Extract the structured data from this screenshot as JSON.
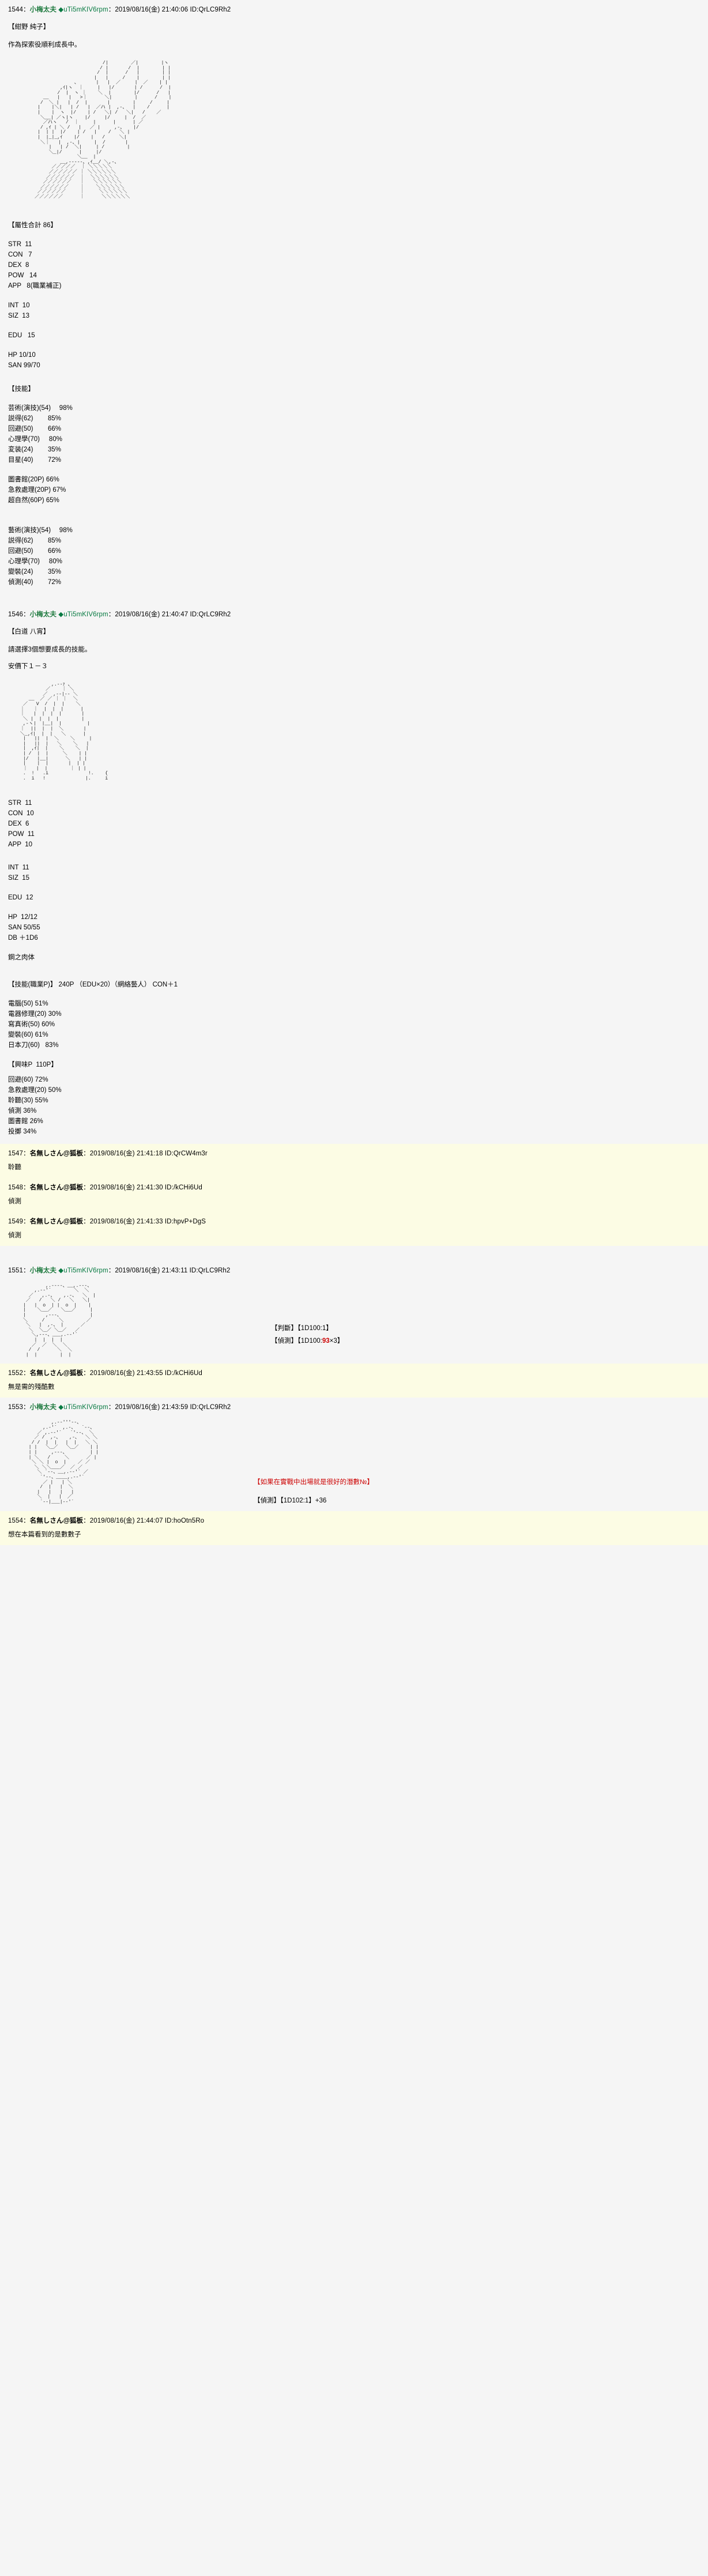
{
  "board": {
    "anon_name": "名無しさん@狐板",
    "trip_name": "小梅太夫",
    "trip_code": "◆uTi5mKIV6rpm",
    "colors": {
      "trip_green": "#1f7a3f",
      "highlight_bg": "#fcfce4",
      "page_bg": "#f5f5f5",
      "dice_red": "#cc0000",
      "dice_blue": "#0000cc"
    }
  },
  "posts": [
    {
      "num": "1544",
      "name": "小梅太夫",
      "trip": "◆uTi5mKIV6rpm",
      "date": "2019/08/16(金) 21:40:06",
      "id": "ID:QrLC9Rh2",
      "title": "【紺野 純子】",
      "line1": "作為探索役順利成長中。",
      "attr_header": "【屬性合計  86】",
      "attrs": [
        "STR  11",
        "CON   7",
        "DEX  8",
        "POW   14",
        "APP   8(職業補正)"
      ],
      "attrs2": [
        "INT  10",
        "SIZ  13"
      ],
      "attrs3": [
        "EDU   15"
      ],
      "attrs4": [
        "HP 10/10",
        "SAN 99/70"
      ],
      "skill_header": "【技能】",
      "skills_a": [
        "芸術(演技)(54)　 98%",
        "説得(62)        85%",
        "回避(50)        66%",
        "心理學(70)     80%",
        "変装(24)        35%",
        "目星(40)        72%"
      ],
      "skills_b": [
        "圖書館(20P) 66%",
        "急救處理(20P) 67%",
        "超自然(60P) 65%"
      ],
      "skills_c": [
        "藝術(演技)(54)　 98%",
        "説得(62)        85%",
        "回避(50)        66%",
        "心理學(70)     80%",
        "變裝(24)        35%",
        "偵測(40)        72%"
      ]
    },
    {
      "num": "1546",
      "name": "小梅太夫",
      "trip": "◆uTi5mKIV6rpm",
      "date": "2019/08/16(金) 21:40:47",
      "id": "ID:QrLC9Rh2",
      "title": "【白道 八宵】",
      "line1": "請選擇3個想要成長的技能。",
      "line2": "安價下１－３",
      "attrs": [
        "STR  11",
        "CON  10",
        "DEX  6",
        "POW  11",
        "APP  10"
      ],
      "attrs2": [
        "INT  11",
        "SIZ  15"
      ],
      "attrs3": [
        "EDU  12"
      ],
      "attrs4": [
        "HP  12/12",
        "SAN 50/55",
        "DB ＋1D6"
      ],
      "trait": "鋼之肉体",
      "job_header": "【技能(職業P)】  240P （EDU×20）（網絡藝人） CON＋1",
      "job_skills": [
        "電腦(50) 51%",
        "電器修理(20) 30%",
        "寫真術(50) 60%",
        "變裝(60) 61%",
        "日本刀(60)   83%"
      ],
      "hobby_header": "【興味P  110P】",
      "hobby_skills": [
        "回避(60) 72%",
        "急救處理(20) 50%",
        "聆聽(30) 55%",
        "偵測 36%",
        "圖書館 26%",
        "投擲 34%"
      ]
    },
    {
      "num": "1547",
      "name": "名無しさん@狐板",
      "date": "2019/08/16(金) 21:41:18",
      "id": "ID:QrCW4m3r",
      "body": "聆聽"
    },
    {
      "num": "1548",
      "name": "名無しさん@狐板",
      "date": "2019/08/16(金) 21:41:30",
      "id": "ID:/kCHi6Ud",
      "body": "偵測"
    },
    {
      "num": "1549",
      "name": "名無しさん@狐板",
      "date": "2019/08/16(金) 21:41:33",
      "id": "ID:hpvP+DgS",
      "body": "偵測"
    },
    {
      "num": "1551",
      "name": "小梅太夫",
      "trip": "◆uTi5mKIV6rpm",
      "date": "2019/08/16(金) 21:43:11",
      "id": "ID:QrLC9Rh2",
      "dice": [
        {
          "label": "【判斷】",
          "expr": "【1D100:1】"
        },
        {
          "label": "【偵測】",
          "expr": "【1D100:",
          "mid": "93",
          "mid2": "】",
          "suffix": "×3】"
        }
      ]
    },
    {
      "num": "1552",
      "name": "名無しさん@狐板",
      "date": "2019/08/16(金) 21:43:55",
      "id": "ID:/kCHi6Ud",
      "body": "無是需的殘酷數"
    },
    {
      "num": "1553",
      "name": "小梅太夫",
      "trip": "◆uTi5mKIV6rpm",
      "date": "2019/08/16(金) 21:43:59",
      "id": "ID:QrLC9Rh2",
      "note": "【如果在實戰中出場就是很好的潛數№】",
      "dice": [
        {
          "label": "【偵測】",
          "expr": "【1D102:1】+36"
        }
      ]
    },
    {
      "num": "1554",
      "name": "名無しさん@狐板",
      "date": "2019/08/16(金) 21:44:07",
      "id": "ID:hoOtn5Ro",
      "body": "想在本篇看到的是數數子"
    }
  ],
  "ascii_art": {
    "art1": "                        /|        ／|        |ヽ\n                       / |       /  |        | |\n                      /  |      /   |        | |\n                     |   |     /    |        | |\n              、      |   |  ／     |  ／    | |\n         ,ｲ|ヽ  ｜     |   |/       | /      /  |\n        /  |  ヽ ｜    ＼  |        |/      /   |\n   __   |   |   >｜      ＼|        |      /    |\n  /  ＼ |   |  /  |       |        |     /     |\n |    |＼|   | /   |  ／ハ |  ,-、  |    /      |\n |    |  ヽ  |/    | /   ＼| /   ＼|   /    ／\n  ＼__| ／ヽ|ヽ    |/     |/     |  /  ／\n   ／ハヽ   /  ｜     |      |      | ／\n  / ,ｲ | ＼ /   |   ／ |     ,-、   |/\n |  | |  |/    | /   |    /   ＼ |\n |  |_|_,ｲ    |/    |   /     ＼|\n  ＼｜   |  ,-、|     |  /       |\n     |   | /  ＼|     | /        |\n     ＼_|/      |     |/\n               ＼__  |\n         __,-‐‐--、,ｲ__/ ＼,-、\n      ／／／／／  ｜ ＼＼＼＼＼\n     ／／／／／／ ｜ ＼＼＼＼＼＼\n    ／／／／／／  ｜  ＼＼＼＼＼＼\n   ／／／／／／   ｜   ＼＼＼＼＼＼\n  ／／／／／／    ｜    ＼＼＼＼＼＼\n ／／／／／／     ｜     ＼＼＼＼＼＼\n／／／／／／      ｜      ＼＼＼＼＼＼",
    "art2": "            ,.-‐ｧ 、\n          ／    ｜ ＼\n         ／  ,-‐|‐- ＼\n    __  ／ ／ ｜ ｜  ＼\n  ／   V  /  |  |    ＼\n ｜   ｜  |  |  |      |\n ｜   |  |  |  |       |\n  ＼ |  |  |  |        |\n  ,-ヽ|  |__|  |         |\n ｜  ||  |  |  ＼       |\n ＼_,ｲ|  |  |   ＼      |\n  |   ||  |  ＼    ＼     |\n  |   ||  |   ＼    ＼   |\n  |  ,ｲ|  |    ＼    ＼  |\n  | /  |  |     ＼    | |\n  |/   |__|      ＼   | |\n  |    |  |       |  | |\n  ｜   |  |        ｜ | |\n  .  !   .i              !.    {\n  .  i   !              |.     i",
    "art3": "          ,.-‐‐-、__,.-‐-、\n      ,.-‐'´        ＼  ＼\n    ／   ,.-、   ,.-、  ＼  |\n   ／   /   ＼ /   ＼   ＼|\n  |   |  o  | |  o  |    |\n  |    ＼__／   ＼__／     |\n  |       ,-‐-、          |\n  ＼     /     ＼        ／\n   ＼   |  ,-、 |      ／\n    ＼  ＼_／ ＼_／   ／\n     ＼,-‐-、___,.-‐'´\n      |  |  |  |\n     ／  ／  ＼  ＼\n    /  /      ＼  ＼\n   |  |        |  |",
    "art4": "            ,.-‐'''‐-、\n         ,.-'´  ,.-、  `‐-、\n       ／ ,.-‐'´   `'‐-、 ＼\n      ／ /  ,-、   ,-、  ＼ ＼\n     / /  |  |   |  |   ＼ ＼\n    | |   ＼_／   ＼_／    | |\n    | |     ,-‐-、        | |\n    | ＼   /     ＼      ／ |\n     ＼ ＼ |  o  |    ／ ／\n      ＼ ＼＼___／  ／ ／\n       ＼ `‐-、__,.-‐'´ ／\n        `'‐-、____,.-‐'´\n         ／ |   | ＼\n        /  |   |  ＼\n       |   |   |   |\n       ＼  |   |  ／\n        `‐-|___|-‐'´"
  }
}
